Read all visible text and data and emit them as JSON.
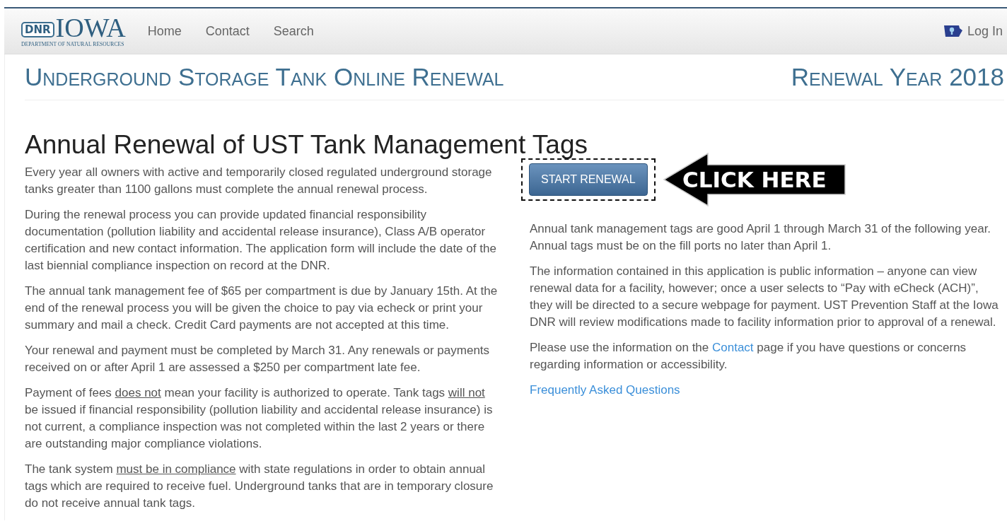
{
  "header": {
    "logo": {
      "wordmark": "IOWA",
      "badge": "DNR",
      "subtitle": "DEPARTMENT OF NATURAL RESOURCES"
    },
    "nav": [
      {
        "label": "Home"
      },
      {
        "label": "Contact"
      },
      {
        "label": "Search"
      }
    ],
    "login": {
      "label": "Log In"
    }
  },
  "page_title": "Underground Storage Tank Online Renewal",
  "renewal_year": "Renewal Year 2018",
  "heading": "Annual Renewal of UST Tank Management Tags",
  "left_paragraphs": [
    [
      {
        "kind": "text",
        "text": "Every year all owners with active and temporarily closed regulated underground storage tanks greater than 1100 gallons must complete the annual renewal process."
      }
    ],
    [
      {
        "kind": "text",
        "text": "During the renewal process you can provide updated financial responsibility documentation (pollution liability and accidental release insurance), Class A/B operator certification and new contact information. The application form will include the date of the last biennial compliance inspection on record at the DNR."
      }
    ],
    [
      {
        "kind": "text",
        "text": "The annual tank management fee of $65 per compartment is due by January 15th. At the end of the renewal process you will be given the choice to pay via echeck or print your summary and mail a check. Credit Card payments are not accepted at this time."
      }
    ],
    [
      {
        "kind": "text",
        "text": "Your renewal and payment must be completed by March 31. Any renewals or payments received on or after April 1 are assessed a $250 per compartment late fee."
      }
    ],
    [
      {
        "kind": "text",
        "text": "Payment of fees "
      },
      {
        "kind": "underline",
        "text": "does not"
      },
      {
        "kind": "text",
        "text": " mean your facility is authorized to operate. Tank tags "
      },
      {
        "kind": "underline",
        "text": "will not"
      },
      {
        "kind": "text",
        "text": " be issued if financial responsibility (pollution liability and accidental release insurance) is not current, a compliance inspection was not completed within the last 2 years or there are outstanding major compliance violations."
      }
    ],
    [
      {
        "kind": "text",
        "text": "The tank system "
      },
      {
        "kind": "underline",
        "text": "must be in compliance"
      },
      {
        "kind": "text",
        "text": " with state regulations in order to obtain annual tags which are required to receive fuel. Underground tanks that are in temporary closure do not receive annual tank tags."
      }
    ]
  ],
  "start_button": "START RENEWAL",
  "callout": "CLICK HERE",
  "right_paragraphs": [
    [
      {
        "kind": "text",
        "text": "Annual tank management tags are good April 1 through March 31 of the following year. Annual tags must be on the fill ports no later than April 1."
      }
    ],
    [
      {
        "kind": "text",
        "text": "The information contained in this application is public information – anyone can view renewal data for a facility, however; once a user selects to “Pay with eCheck (ACH)”, they will be directed to a secure webpage for payment. UST Prevention Staff at the Iowa DNR will review modifications made to facility information prior to approval of a renewal."
      }
    ],
    [
      {
        "kind": "text",
        "text": "Please use the information on the "
      },
      {
        "kind": "link",
        "text": "Contact"
      },
      {
        "kind": "text",
        "text": " page if you have questions or concerns regarding information or accessibility."
      }
    ]
  ],
  "faq_link": "Frequently Asked Questions"
}
